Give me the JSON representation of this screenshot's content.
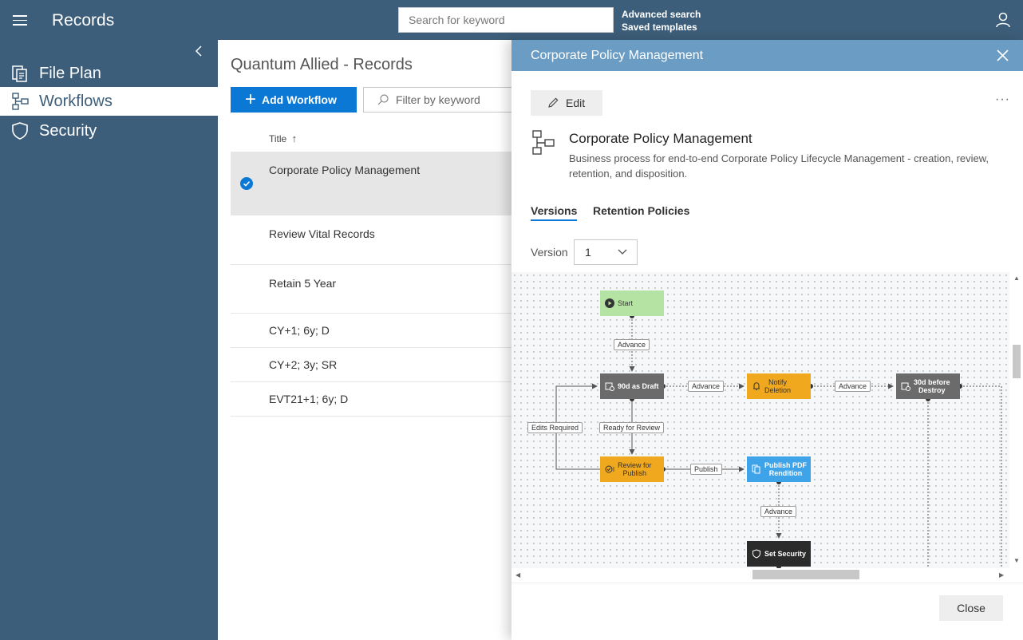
{
  "app": {
    "title": "Records"
  },
  "search": {
    "placeholder": "Search for keyword"
  },
  "top_links": {
    "advanced_search": "Advanced search",
    "saved_templates": "Saved templates"
  },
  "sidebar": {
    "items": [
      {
        "label": "File Plan",
        "icon": "file-plan-icon"
      },
      {
        "label": "Workflows",
        "icon": "workflow-icon",
        "active": true
      },
      {
        "label": "Security",
        "icon": "shield-icon"
      }
    ]
  },
  "main": {
    "title": "Quantum Allied - Records",
    "add_button": "Add Workflow",
    "filter_placeholder": "Filter by keyword",
    "column_title": "Title",
    "sort_indicator": "↑",
    "rows": [
      {
        "title": "Corporate Policy Management",
        "selected": true
      },
      {
        "title": "Review Vital Records"
      },
      {
        "title": "Retain 5 Year"
      },
      {
        "title": "CY+1; 6y; D"
      },
      {
        "title": "CY+2; 3y; SR"
      },
      {
        "title": "EVT21+1; 6y; D"
      }
    ]
  },
  "panel": {
    "header_title": "Corporate Policy Management",
    "edit_label": "Edit",
    "more_label": "···",
    "workflow_title": "Corporate Policy Management",
    "description": "Business process for end-to-end Corporate Policy Lifecycle Management - creation, review, retention, and disposition.",
    "tabs": [
      "Versions",
      "Retention Policies"
    ],
    "version_label": "Version",
    "version_value": "1",
    "close_label": "Close"
  },
  "diagram": {
    "nodes": {
      "start": "Start",
      "draft": "90d as Draft",
      "notify1": "Notify",
      "notify2": "Deletion",
      "destroy1": "30d before",
      "destroy2": "Destroy",
      "review1": "Review for",
      "review2": "Publish",
      "publish1": "Publish PDF",
      "publish2": "Rendition",
      "security": "Set Security"
    },
    "edges": {
      "advance1": "Advance",
      "advance2": "Advance",
      "advance3": "Advance",
      "advance4": "Advance",
      "edits_required": "Edits Required",
      "ready_for_review": "Ready for Review",
      "publish": "Publish"
    },
    "colors": {
      "start": "#b5e3a4",
      "gray_step": "#6b6b6b",
      "notify": "#f0a81e",
      "publish": "#3ea3e8",
      "security": "#2b2b2b"
    }
  },
  "colors": {
    "nav": "#3d5e7a",
    "panel_header": "#6b9cc4",
    "accent": "#0a78d4"
  }
}
